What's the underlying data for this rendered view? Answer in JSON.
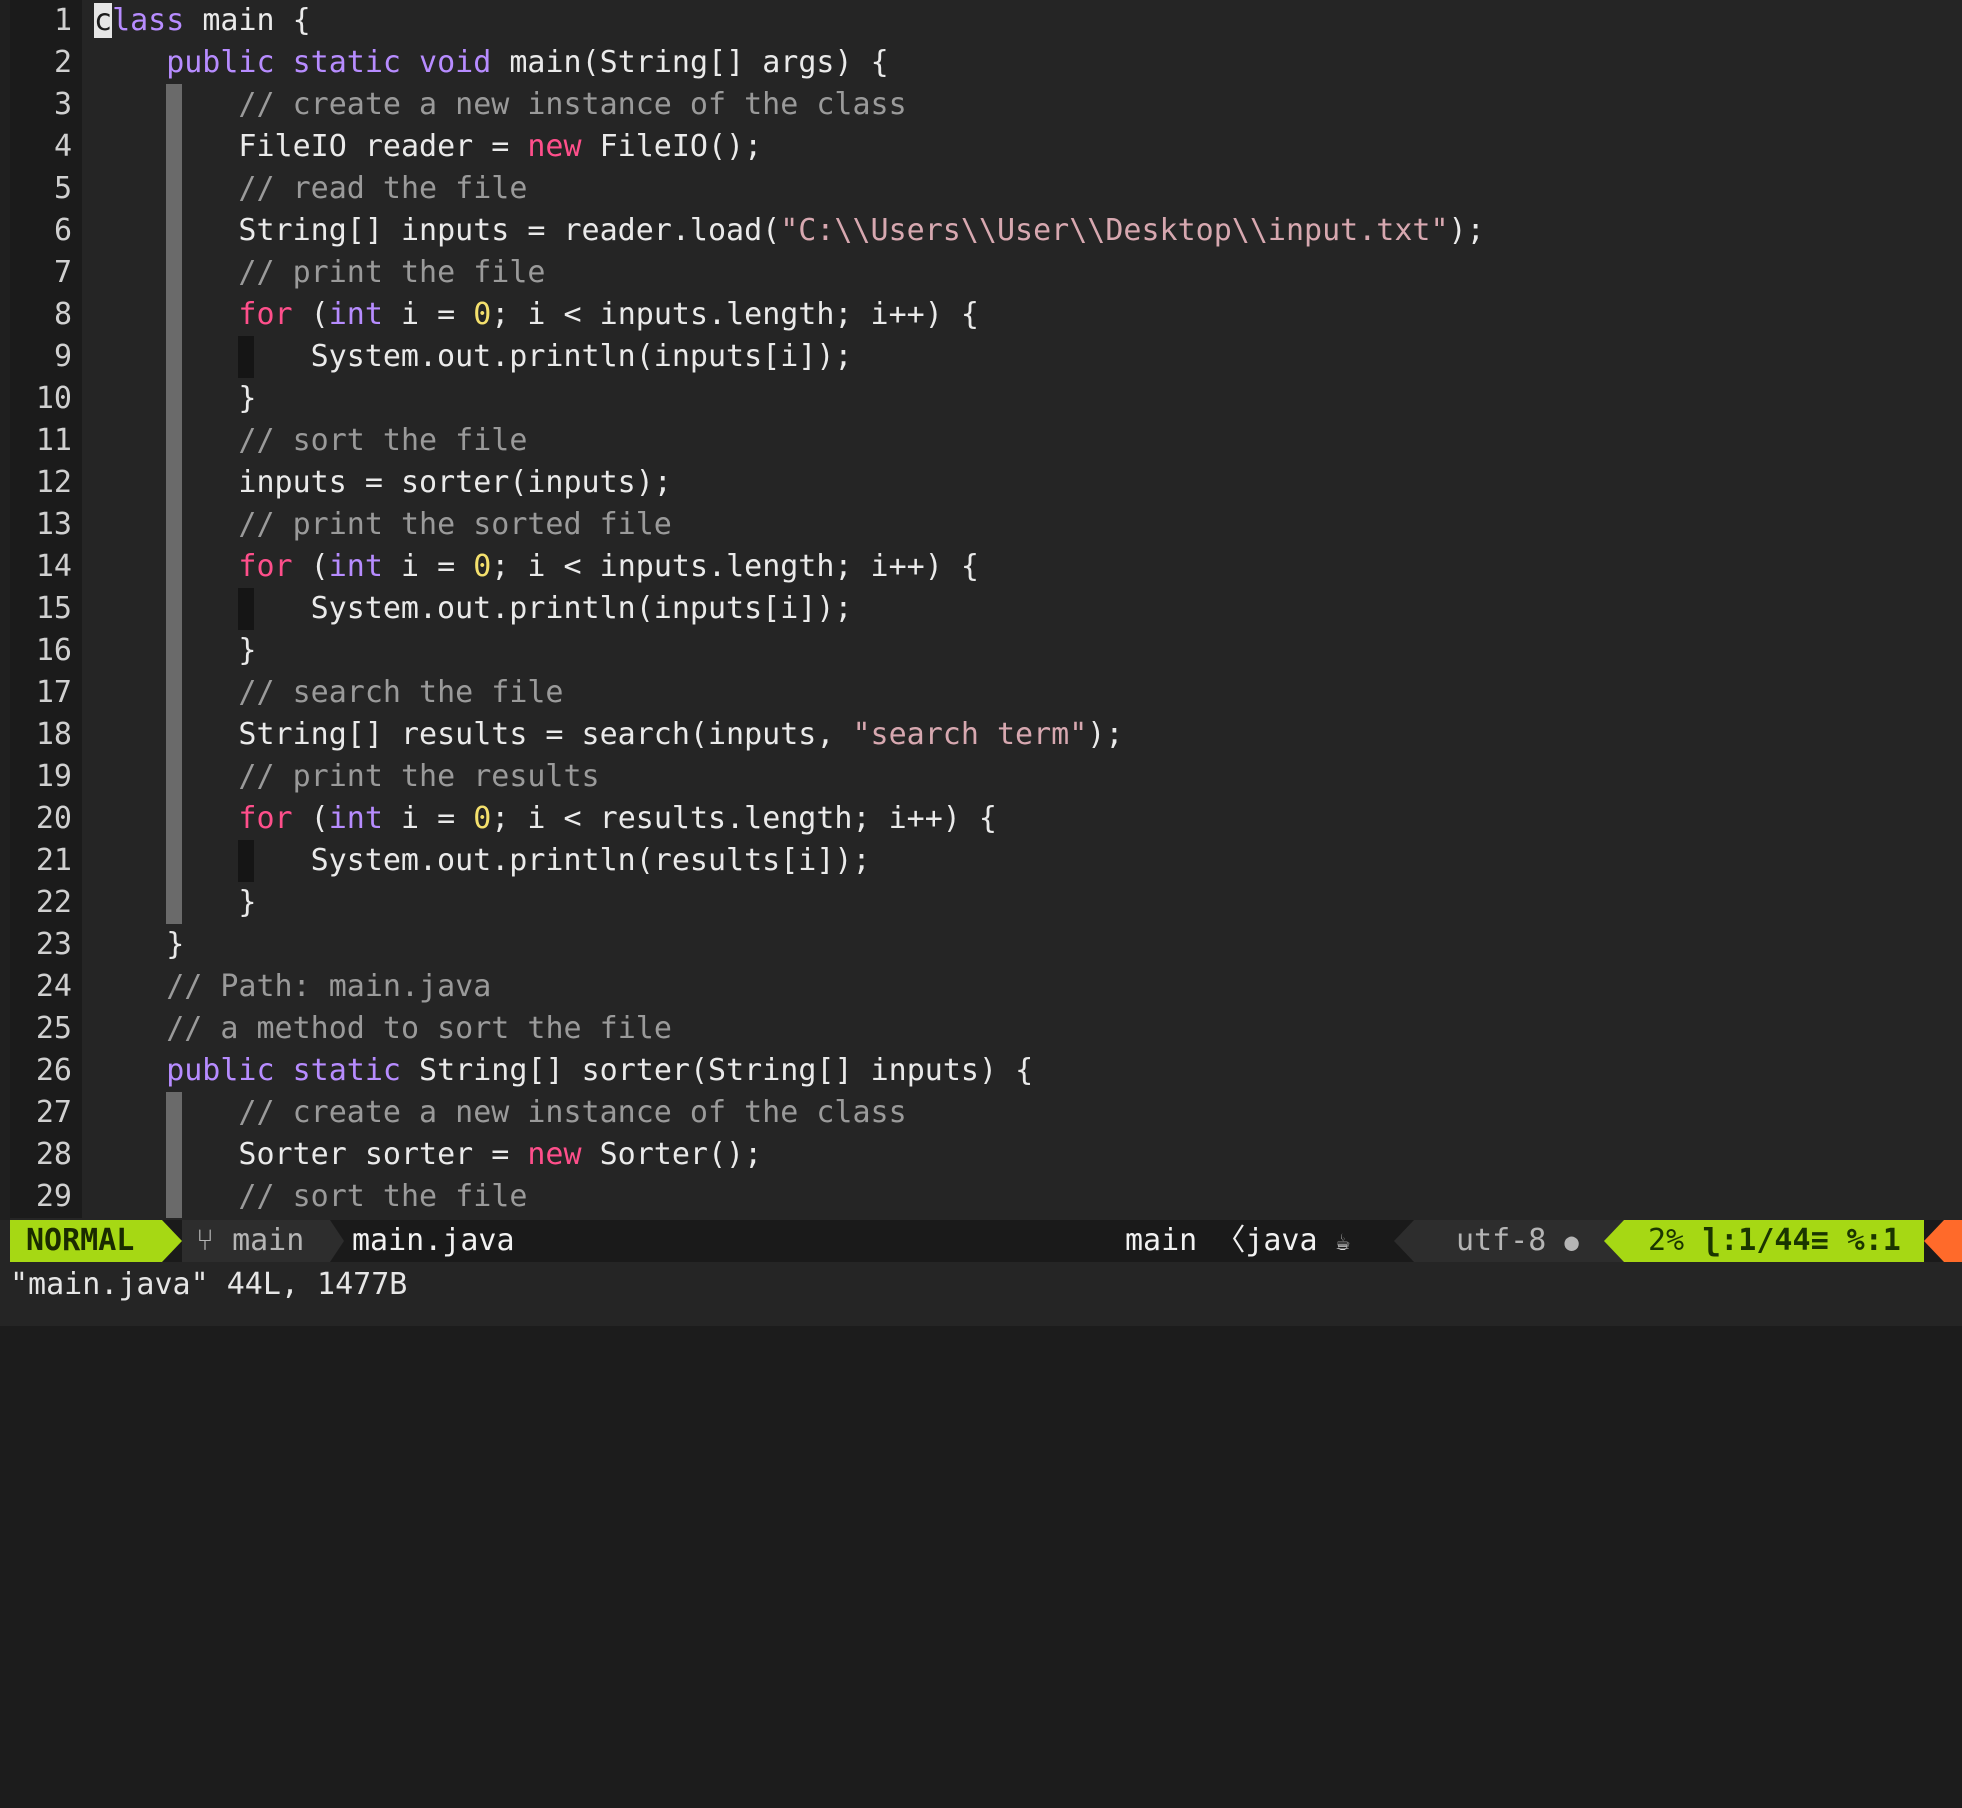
{
  "editor": {
    "lines": [
      {
        "n": "1",
        "indent": 0,
        "bars": [],
        "tokens": [
          {
            "t": "c",
            "k": "cursor"
          },
          {
            "t": "lass",
            "k": "kw"
          },
          {
            "t": " main {",
            "k": ""
          }
        ]
      },
      {
        "n": "2",
        "indent": 1,
        "bars": [],
        "tokens": [
          {
            "t": "public static void",
            "k": "kw"
          },
          {
            "t": " main(String[] args) {",
            "k": ""
          }
        ]
      },
      {
        "n": "3",
        "indent": 2,
        "bars": [
          "g"
        ],
        "tokens": [
          {
            "t": "// create a new instance of the class",
            "k": "cmt"
          }
        ]
      },
      {
        "n": "4",
        "indent": 2,
        "bars": [
          "g"
        ],
        "tokens": [
          {
            "t": "FileIO reader = ",
            "k": ""
          },
          {
            "t": "new",
            "k": "new"
          },
          {
            "t": " FileIO();",
            "k": ""
          }
        ]
      },
      {
        "n": "5",
        "indent": 2,
        "bars": [
          "g"
        ],
        "tokens": [
          {
            "t": "// read the file",
            "k": "cmt"
          }
        ]
      },
      {
        "n": "6",
        "indent": 2,
        "bars": [
          "g"
        ],
        "tokens": [
          {
            "t": "String[] inputs = reader.load(",
            "k": ""
          },
          {
            "t": "\"C:\\\\Users\\\\User\\\\Desktop\\\\input.txt\"",
            "k": "str"
          },
          {
            "t": ");",
            "k": ""
          }
        ]
      },
      {
        "n": "7",
        "indent": 2,
        "bars": [
          "g"
        ],
        "tokens": [
          {
            "t": "// print the file",
            "k": "cmt"
          }
        ]
      },
      {
        "n": "8",
        "indent": 2,
        "bars": [
          "g"
        ],
        "tokens": [
          {
            "t": "for",
            "k": "new"
          },
          {
            "t": " (",
            "k": ""
          },
          {
            "t": "int",
            "k": "kw"
          },
          {
            "t": " i = ",
            "k": ""
          },
          {
            "t": "0",
            "k": "num"
          },
          {
            "t": "; i < inputs.length; i++) {",
            "k": ""
          }
        ]
      },
      {
        "n": "9",
        "indent": 3,
        "bars": [
          "g",
          "d"
        ],
        "tokens": [
          {
            "t": "System.out.println(inputs[i]);",
            "k": ""
          }
        ]
      },
      {
        "n": "10",
        "indent": 2,
        "bars": [
          "g"
        ],
        "tokens": [
          {
            "t": "}",
            "k": ""
          }
        ]
      },
      {
        "n": "11",
        "indent": 2,
        "bars": [
          "g"
        ],
        "tokens": [
          {
            "t": "// sort the file",
            "k": "cmt"
          }
        ]
      },
      {
        "n": "12",
        "indent": 2,
        "bars": [
          "g"
        ],
        "tokens": [
          {
            "t": "inputs = sorter(inputs);",
            "k": ""
          }
        ]
      },
      {
        "n": "13",
        "indent": 2,
        "bars": [
          "g"
        ],
        "tokens": [
          {
            "t": "// print the sorted file",
            "k": "cmt"
          }
        ]
      },
      {
        "n": "14",
        "indent": 2,
        "bars": [
          "g"
        ],
        "tokens": [
          {
            "t": "for",
            "k": "new"
          },
          {
            "t": " (",
            "k": ""
          },
          {
            "t": "int",
            "k": "kw"
          },
          {
            "t": " i = ",
            "k": ""
          },
          {
            "t": "0",
            "k": "num"
          },
          {
            "t": "; i < inputs.length; i++) {",
            "k": ""
          }
        ]
      },
      {
        "n": "15",
        "indent": 3,
        "bars": [
          "g",
          "d"
        ],
        "tokens": [
          {
            "t": "System.out.println(inputs[i]);",
            "k": ""
          }
        ]
      },
      {
        "n": "16",
        "indent": 2,
        "bars": [
          "g"
        ],
        "tokens": [
          {
            "t": "}",
            "k": ""
          }
        ]
      },
      {
        "n": "17",
        "indent": 2,
        "bars": [
          "g"
        ],
        "tokens": [
          {
            "t": "// search the file",
            "k": "cmt"
          }
        ]
      },
      {
        "n": "18",
        "indent": 2,
        "bars": [
          "g"
        ],
        "tokens": [
          {
            "t": "String[] results = search(inputs, ",
            "k": ""
          },
          {
            "t": "\"search term\"",
            "k": "str"
          },
          {
            "t": ");",
            "k": ""
          }
        ]
      },
      {
        "n": "19",
        "indent": 2,
        "bars": [
          "g"
        ],
        "tokens": [
          {
            "t": "// print the results",
            "k": "cmt"
          }
        ]
      },
      {
        "n": "20",
        "indent": 2,
        "bars": [
          "g"
        ],
        "tokens": [
          {
            "t": "for",
            "k": "new"
          },
          {
            "t": " (",
            "k": ""
          },
          {
            "t": "int",
            "k": "kw"
          },
          {
            "t": " i = ",
            "k": ""
          },
          {
            "t": "0",
            "k": "num"
          },
          {
            "t": "; i < results.length; i++) {",
            "k": ""
          }
        ]
      },
      {
        "n": "21",
        "indent": 3,
        "bars": [
          "g",
          "d"
        ],
        "tokens": [
          {
            "t": "System.out.println(results[i]);",
            "k": ""
          }
        ]
      },
      {
        "n": "22",
        "indent": 2,
        "bars": [
          "g"
        ],
        "tokens": [
          {
            "t": "}",
            "k": ""
          }
        ]
      },
      {
        "n": "23",
        "indent": 1,
        "bars": [],
        "tokens": [
          {
            "t": "}",
            "k": ""
          }
        ]
      },
      {
        "n": "24",
        "indent": 1,
        "bars": [],
        "tokens": [
          {
            "t": "// Path: main.java",
            "k": "cmt"
          }
        ]
      },
      {
        "n": "25",
        "indent": 1,
        "bars": [],
        "tokens": [
          {
            "t": "// a method to sort the file",
            "k": "cmt"
          }
        ]
      },
      {
        "n": "26",
        "indent": 1,
        "bars": [],
        "tokens": [
          {
            "t": "public static",
            "k": "kw"
          },
          {
            "t": " String[] sorter(String[] inputs) {",
            "k": ""
          }
        ]
      },
      {
        "n": "27",
        "indent": 2,
        "bars": [
          "g"
        ],
        "tokens": [
          {
            "t": "// create a new instance of the class",
            "k": "cmt"
          }
        ]
      },
      {
        "n": "28",
        "indent": 2,
        "bars": [
          "g"
        ],
        "tokens": [
          {
            "t": "Sorter sorter = ",
            "k": ""
          },
          {
            "t": "new",
            "k": "new"
          },
          {
            "t": " Sorter();",
            "k": ""
          }
        ]
      },
      {
        "n": "29",
        "indent": 2,
        "bars": [
          "g"
        ],
        "tokens": [
          {
            "t": "// sort the file",
            "k": "cmt"
          }
        ]
      }
    ]
  },
  "statusline": {
    "mode": "NORMAL",
    "branch_icon": "git-branch-icon",
    "branch": "main",
    "filename": "main.java",
    "function": "main",
    "separator": "〈",
    "filetype": "java",
    "filetype_icon": "java-icon",
    "encoding": "utf-8",
    "os_icon": "apple-icon",
    "percent": "2%",
    "line_icon": "line-number-icon",
    "position": ":1/44",
    "column": "≡ %:1"
  },
  "cmdline": {
    "message": "\"main.java\" 44L, 1477B"
  },
  "colors": {
    "background": "#252525",
    "keyword": "#b78cff",
    "new_keyword": "#ff4f8b",
    "number": "#f4e06d",
    "string": "#d7a8b0",
    "comment": "#9a9a9a",
    "mode_bg": "#a6d814",
    "warn": "#ff6a2a"
  }
}
